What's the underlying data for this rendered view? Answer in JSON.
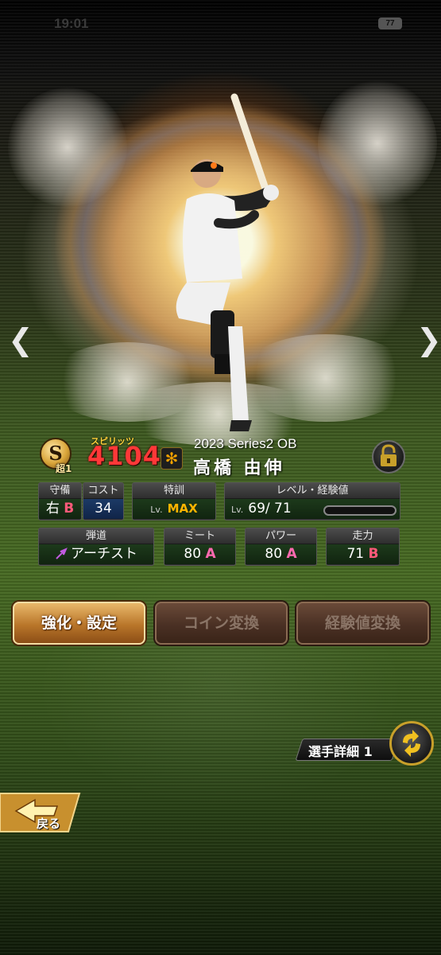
{
  "status_bar": {
    "time": "19:01",
    "battery": "77"
  },
  "card": {
    "rank_letter": "S",
    "rank_sub": "超1",
    "spirit_label": "スピリッツ",
    "spirit_value": "4104",
    "series": "2023 Series2 OB",
    "player_name": "高橋 由伸"
  },
  "stats": {
    "position": {
      "label": "守備",
      "value": "右",
      "grade": "B"
    },
    "cost": {
      "label": "コスト",
      "value": "34"
    },
    "special_training": {
      "label": "特訓",
      "lv_prefix": "Lv.",
      "value": "MAX"
    },
    "level_exp": {
      "label": "レベル・経験値",
      "lv_prefix": "Lv.",
      "value": "69/ 71"
    },
    "trajectory": {
      "label": "弾道",
      "value": "アーチスト"
    },
    "contact": {
      "label": "ミート",
      "value": "80",
      "grade": "A"
    },
    "power": {
      "label": "パワー",
      "value": "80",
      "grade": "A"
    },
    "speed": {
      "label": "走力",
      "value": "71",
      "grade": "B"
    }
  },
  "actions": {
    "enhance_label": "強化・設定",
    "coin_convert_label": "コイン変換",
    "exp_convert_label": "経験値変換"
  },
  "detail_label": "選手詳細 1",
  "back_label": "戻る",
  "icons": [
    "chevron-left-icon",
    "chevron-right-icon",
    "lock-icon",
    "refresh-icon",
    "back-arrow-icon",
    "team-logo-icon",
    "trajectory-arrow-icon"
  ],
  "colors": {
    "spirit_red": "#ff3838",
    "grade_b": "#ff5a7a",
    "grade_a": "#ff6ab0",
    "max_orange": "#ffb400",
    "button_gold": "#c8842e"
  }
}
